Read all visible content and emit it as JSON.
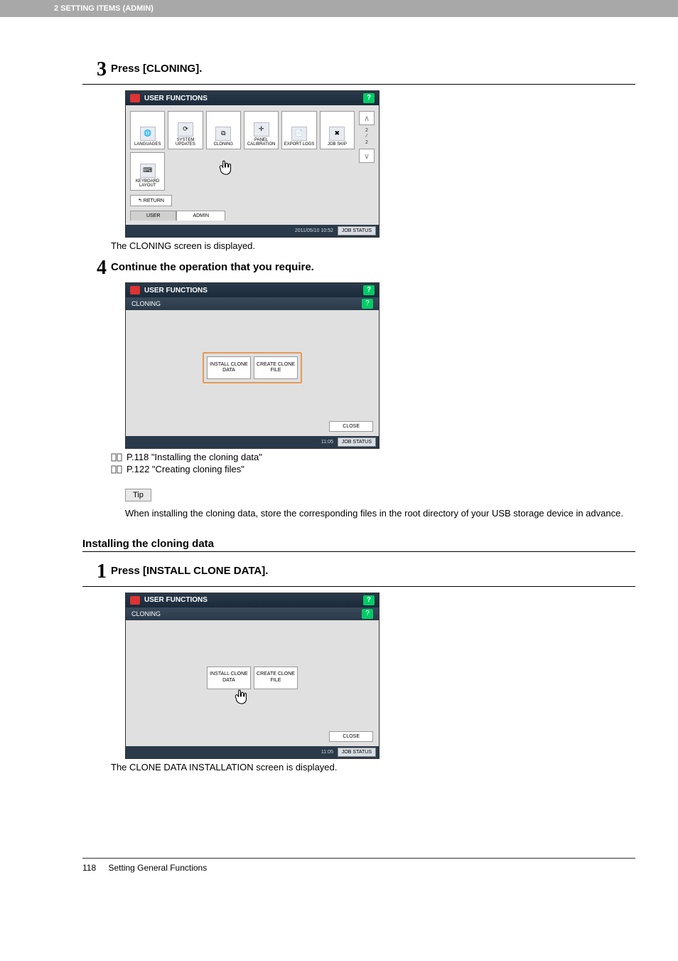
{
  "header": {
    "chapter": "2 SETTING ITEMS (ADMIN)"
  },
  "step3": {
    "num": "3",
    "title": "Press [CLONING].",
    "result": "The CLONING screen is displayed.",
    "screen": {
      "title": "USER FUNCTIONS",
      "help": "?",
      "buttons": [
        "LANGUAGES",
        "SYSTEM UPDATES",
        "CLONING",
        "PANEL CALIBRATION",
        "EXPORT LOGS",
        "JOB SKIP",
        "KEYBOARD LAYOUT"
      ],
      "pager": {
        "current": "2",
        "total": "2"
      },
      "return": "↰  RETURN",
      "tabs": {
        "user": "USER",
        "admin": "ADMIN"
      },
      "timestamp": "2011/05/10\n10:52",
      "jobstatus": "JOB STATUS"
    }
  },
  "step4": {
    "num": "4",
    "title": "Continue the operation that you require.",
    "screen": {
      "title": "USER FUNCTIONS",
      "subtitle": "CLONING",
      "help": "?",
      "btn1": "INSTALL CLONE DATA",
      "btn2": "CREATE CLONE FILE",
      "close": "CLOSE",
      "timestamp": "11:05",
      "jobstatus": "JOB STATUS"
    },
    "ref1": "P.118 \"Installing the cloning data\"",
    "ref2": "P.122 \"Creating cloning files\"",
    "tip_label": "Tip",
    "tip_body": "When installing the cloning data, store the corresponding files in the root directory of your USB storage device in advance."
  },
  "section2": {
    "heading": "Installing the cloning data",
    "step1": {
      "num": "1",
      "title": "Press [INSTALL CLONE DATA].",
      "screen": {
        "title": "USER FUNCTIONS",
        "subtitle": "CLONING",
        "help": "?",
        "btn1": "INSTALL CLONE DATA",
        "btn2": "CREATE CLONE FILE",
        "close": "CLOSE",
        "timestamp": "11:05",
        "jobstatus": "JOB STATUS"
      },
      "result": "The CLONE DATA INSTALLATION screen is displayed."
    }
  },
  "footer": {
    "page": "118",
    "chapter_title": "Setting General Functions"
  }
}
